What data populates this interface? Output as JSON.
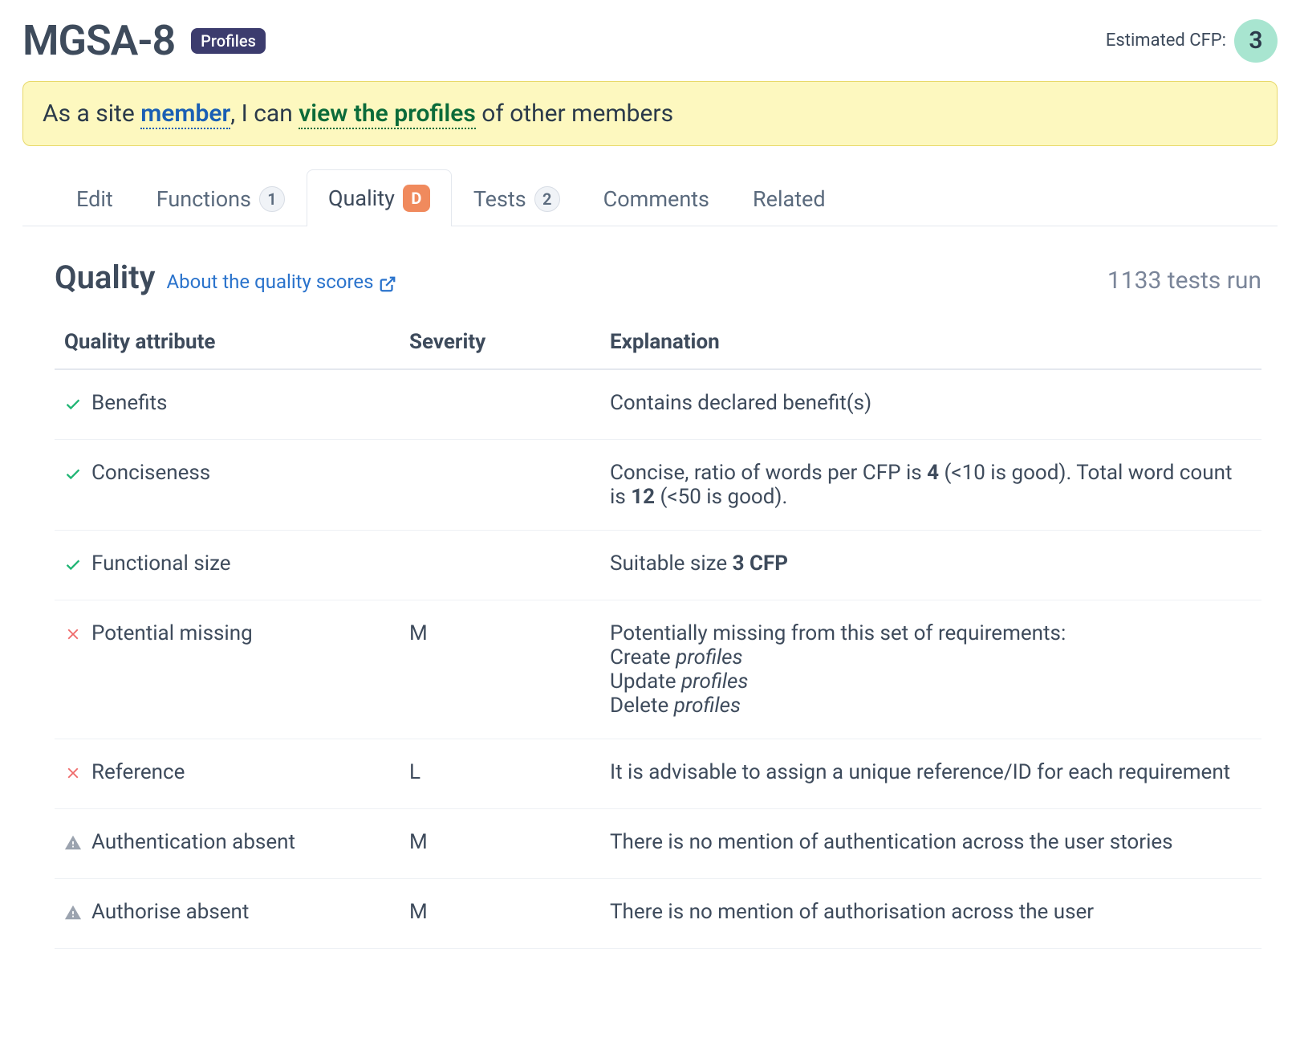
{
  "header": {
    "title": "MGSA-8",
    "tag": "Profiles",
    "cfp_label": "Estimated CFP:",
    "cfp_value": "3"
  },
  "story": {
    "prefix": "As a site ",
    "actor": "member",
    "mid": ", I can ",
    "action": "view the profiles",
    "suffix": " of other members"
  },
  "tabs": {
    "edit": "Edit",
    "functions": "Functions",
    "functions_count": "1",
    "quality": "Quality",
    "quality_grade": "D",
    "tests": "Tests",
    "tests_count": "2",
    "comments": "Comments",
    "related": "Related"
  },
  "section": {
    "title": "Quality",
    "about": "About the quality scores",
    "tests_run": "1133 tests run"
  },
  "table": {
    "headers": {
      "attr": "Quality attribute",
      "sev": "Severity",
      "exp": "Explanation"
    },
    "rows": [
      {
        "icon": "check",
        "attr": "Benefits",
        "sev": "",
        "exp": "Contains declared benefit(s)"
      },
      {
        "icon": "check",
        "attr": "Conciseness",
        "sev": "",
        "exp": "Concise, ratio of words per CFP is <strong>4</strong> (<10 is good). Total word count is <strong>12</strong> (<50 is good)."
      },
      {
        "icon": "check",
        "attr": "Functional size",
        "sev": "",
        "exp": "Suitable size <strong>3 CFP</strong>"
      },
      {
        "icon": "cross",
        "attr": "Potential missing",
        "sev": "M",
        "exp": "Potentially missing from this set of requirements:<br>Create <em>profiles</em><br>Update <em>profiles</em><br>Delete <em>profiles</em>"
      },
      {
        "icon": "cross",
        "attr": "Reference",
        "sev": "L",
        "exp": "It is advisable to assign a unique reference/ID for each requirement"
      },
      {
        "icon": "warn",
        "attr": "Authentication absent",
        "sev": "M",
        "exp": "There is no mention of authentication across the user stories"
      },
      {
        "icon": "warn",
        "attr": "Authorise absent",
        "sev": "M",
        "exp": "There is no mention of authorisation across the user"
      }
    ]
  }
}
